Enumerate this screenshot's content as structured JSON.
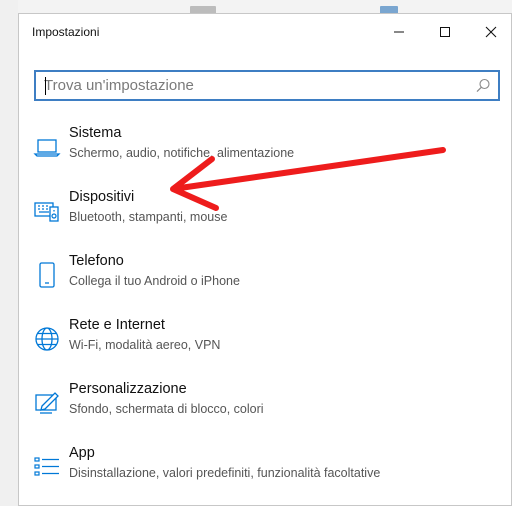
{
  "window": {
    "title": "Impostazioni",
    "controls": {
      "minimize": "minimize-icon",
      "maximize": "maximize-icon",
      "close": "close-icon"
    }
  },
  "search": {
    "placeholder": "Trova un'impostazione",
    "value": "",
    "icon": "search-icon"
  },
  "categories": [
    {
      "icon": "laptop-icon",
      "title": "Sistema",
      "description": "Schermo, audio, notifiche, alimentazione"
    },
    {
      "icon": "devices-icon",
      "title": "Dispositivi",
      "description": "Bluetooth, stampanti, mouse"
    },
    {
      "icon": "phone-icon",
      "title": "Telefono",
      "description": "Collega il tuo Android o iPhone"
    },
    {
      "icon": "globe-icon",
      "title": "Rete e Internet",
      "description": "Wi-Fi, modalità aereo, VPN"
    },
    {
      "icon": "personalization-icon",
      "title": "Personalizzazione",
      "description": "Sfondo, schermata di blocco, colori"
    },
    {
      "icon": "apps-icon",
      "title": "App",
      "description": "Disinstallazione, valori predefiniti, funzionalità facoltative"
    }
  ],
  "colors": {
    "accent": "#0078d7",
    "search_border": "#3e7ec3",
    "annotation_arrow": "#ee1c1c"
  }
}
